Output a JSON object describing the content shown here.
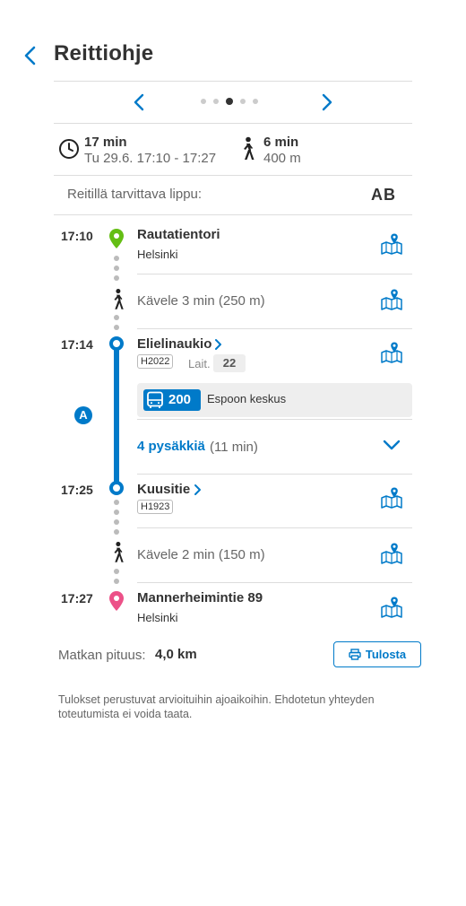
{
  "header": {
    "title": "Reittiohje"
  },
  "pager": {
    "count": 5,
    "active_index": 2
  },
  "summary": {
    "duration": "17 min",
    "date_time": "Tu 29.6. 17:10 - 17:27",
    "walk_duration": "6 min",
    "walk_distance": "400 m"
  },
  "ticket": {
    "label": "Reitillä tarvittava lippu:",
    "zones": "AB"
  },
  "itinerary": {
    "origin": {
      "time": "17:10",
      "name": "Rautatientori",
      "city": "Helsinki"
    },
    "walk1": {
      "text": "Kävele 3 min (250 m)"
    },
    "board": {
      "time": "17:14",
      "name": "Elielinaukio",
      "code": "H2022",
      "platform_label": "Lait.",
      "platform": "22"
    },
    "route": {
      "number": "200",
      "destination": "Espoon keskus",
      "zone": "A"
    },
    "stops": {
      "count_label": "4 pysäkkiä",
      "duration": "(11 min)"
    },
    "alight": {
      "time": "17:25",
      "name": "Kuusitie",
      "code": "H1923"
    },
    "walk2": {
      "text": "Kävele 2 min (150 m)"
    },
    "destination": {
      "time": "17:27",
      "name": "Mannerheimintie 89",
      "city": "Helsinki"
    }
  },
  "footer": {
    "length_label": "Matkan pituus:",
    "length_value": "4,0 km",
    "print_label": "Tulosta",
    "disclaimer": "Tulokset perustuvat arvioituihin ajoaikoihin. Ehdotetun yhteyden toteutumista ei voida taata."
  },
  "colors": {
    "accent": "#007ac9",
    "origin": "#64be14",
    "destination": "#ec5188",
    "text": "#333333",
    "muted": "#666666"
  },
  "icons": [
    "back-icon",
    "chevron-left-icon",
    "chevron-right-icon",
    "clock-icon",
    "walk-icon",
    "map-pin-icon",
    "map-icon",
    "bus-icon",
    "chevron-down-icon",
    "print-icon"
  ]
}
